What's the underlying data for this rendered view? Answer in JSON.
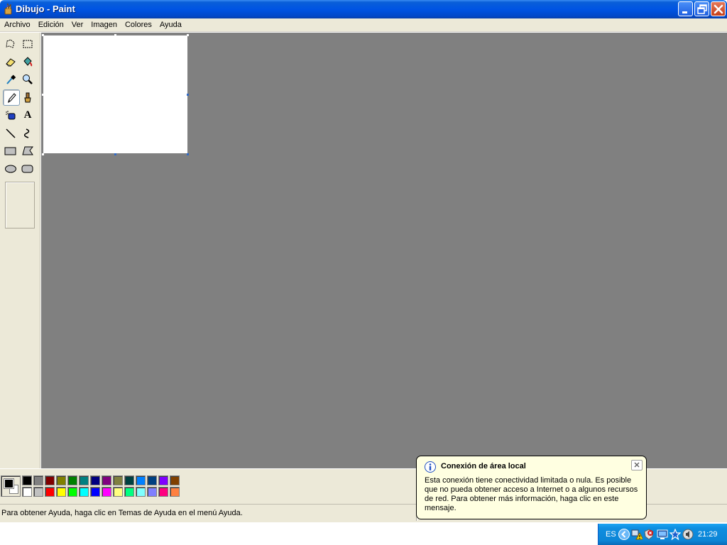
{
  "window": {
    "title": "Dibujo - Paint",
    "buttons": {
      "minimize": "minimize",
      "restore": "restore",
      "close": "close"
    }
  },
  "menu": {
    "items": [
      "Archivo",
      "Edición",
      "Ver",
      "Imagen",
      "Colores",
      "Ayuda"
    ]
  },
  "toolbox": {
    "tools": [
      "free-form-select-icon",
      "rect-select-icon",
      "eraser-icon",
      "fill-bucket-icon",
      "color-picker-icon",
      "magnifier-icon",
      "pencil-icon",
      "brush-icon",
      "airbrush-icon",
      "text-icon",
      "line-icon",
      "curve-icon",
      "rectangle-icon",
      "polygon-icon",
      "ellipse-icon",
      "rounded-rect-icon"
    ],
    "selected_tool": "pencil-icon",
    "text_tool_glyph": "A"
  },
  "palette": {
    "foreground": "#000000",
    "background": "#ffffff",
    "row1": [
      "#000000",
      "#808080",
      "#800000",
      "#808000",
      "#008000",
      "#008080",
      "#000080",
      "#800080",
      "#808040",
      "#004040",
      "#0080ff",
      "#004080",
      "#8000ff",
      "#804000"
    ],
    "row2": [
      "#ffffff",
      "#c0c0c0",
      "#ff0000",
      "#ffff00",
      "#00ff00",
      "#00ffff",
      "#0000ff",
      "#ff00ff",
      "#ffff80",
      "#00ff80",
      "#80ffff",
      "#8080ff",
      "#ff0080",
      "#ff8040"
    ]
  },
  "status": {
    "text": "Para obtener Ayuda, haga clic en Temas de Ayuda en el menú Ayuda."
  },
  "balloon": {
    "title": "Conexión de área local",
    "text": "Esta conexión tiene conectividad limitada o nula. Es posible que no pueda obtener acceso a Internet o a algunos recursos de red. Para obtener más información, haga clic en este mensaje."
  },
  "tray": {
    "language": "ES",
    "clock": "21:29"
  }
}
